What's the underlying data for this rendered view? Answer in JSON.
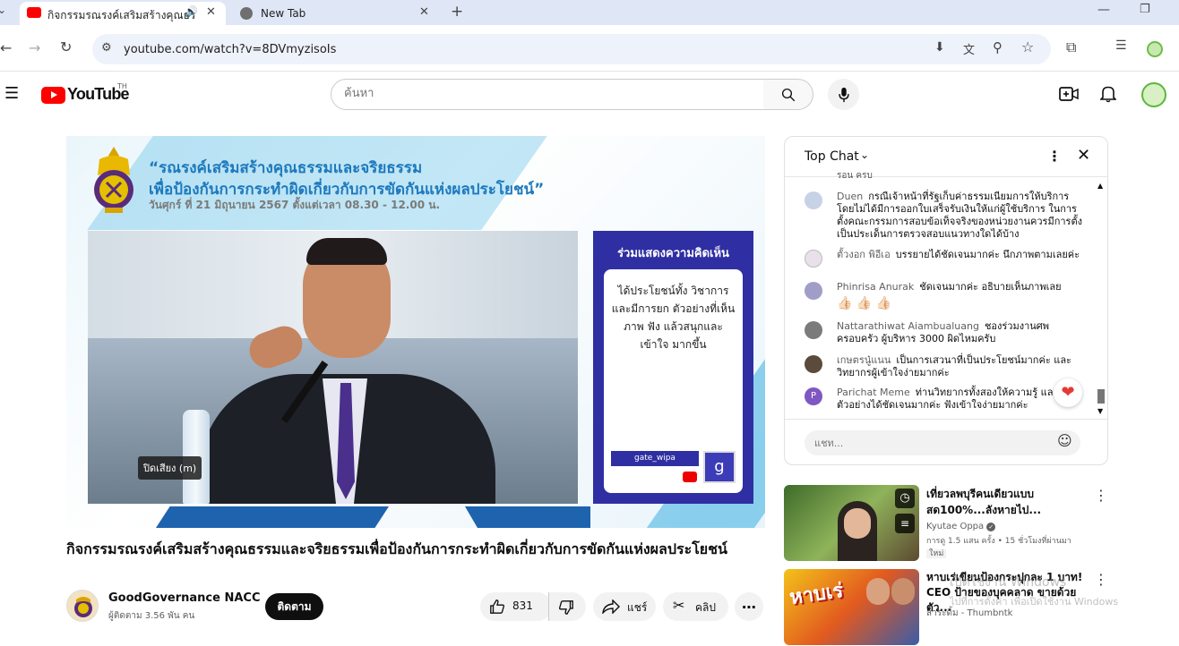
{
  "browser": {
    "tabs": [
      {
        "title": "กิจกรรมรณรงค์เสริมสร้างคุณธรร",
        "active": true
      },
      {
        "title": "New Tab",
        "active": false
      }
    ],
    "url": "youtube.com/watch?v=8DVmyzisoIs"
  },
  "youtube": {
    "logo_text": "YouTube",
    "country_code": "TH",
    "search_placeholder": "ค้นหา"
  },
  "video": {
    "banner_line1": "“รณรงค์เสริมสร้างคุณธรรมและจริยธรรม",
    "banner_line2": "เพื่อป้องกันการกระทำผิดเกี่ยวกับการขัดกันแห่งผลประโยชน์”",
    "banner_date": "วันศุกร์ ที่ 21 มิถุนายน 2567 ตั้งแต่เวลา 08.30 - 12.00 น.",
    "comment_panel_title": "ร่วมแสดงความคิดเห็น",
    "comment_panel_text": "ได้ประโยชน์ทั้ง วิชาการ และมีการยก ตัวอย่างที่เห็นภาพ ฟัง แล้วสนุกและเข้าใจ มากขึ้น",
    "comment_user": "gate_wipa",
    "comment_avatar_letter": "g",
    "mute_tooltip": "ปิดเสียง (m)",
    "title": "กิจกรรมรณรงค์เสริมสร้างคุณธรรมและจริยธรรมเพื่อป้องกันการกระทำผิดเกี่ยวกับการขัดกันแห่งผลประโยชน์",
    "channel_name": "GoodGovernance NACC",
    "subscribers": "ผู้ติดตาม 3.56 พัน คน",
    "subscribe_label": "ติดตาม",
    "like_count": "831",
    "share_label": "แชร์",
    "clip_label": "คลิป"
  },
  "chat": {
    "title": "Top Chat",
    "partial_top": "ร้อน ครับ",
    "messages": [
      {
        "author": "Duen",
        "text": "กรณีเจ้าหน้าที่รัฐเก็บค่าธรรมเนียมการให้บริการโดยไม่ได้มีการออกใบเสร็จรับเงินให้แก่ผู้ใช้บริการ ในการตั้งคณะกรรมการสอบข้อเท็จจริงของหน่วยงานควรมีการตั้งเป็นประเด็นการตรวจสอบแนวทางใดได้บ้าง"
      },
      {
        "author": "ตั้วงอก พิอีเอ",
        "text": "บรรยายได้ชัดเจนมากค่ะ นึกภาพตามเลยค่ะ"
      },
      {
        "author": "Phinrisa Anurak",
        "text": "ชัดเจนมากค่ะ อธิบายเห็นภาพเลย",
        "emoji": "👍🏻 👍🏻 👍🏻"
      },
      {
        "author": "Nattarathiwat Aiambualuang",
        "text": "ชองร่วมงานศพครอบครัว ผู้บริหาร 3000 ผิดไหมครับ"
      },
      {
        "author": "เกษตรนู๋แนน",
        "text": "เป็นการเสวนาที่เป็นประโยชน์มากค่ะ และวิทยากรผู้เข้าใจง่ายมากค่ะ"
      },
      {
        "author": "Parichat Meme",
        "text": "ท่านวิทยากรทั้งสองให้ความรู้ และยกตัวอย่างได้ชัดเจนมากค่ะ ฟังเข้าใจง่ายมากค่ะ",
        "avatar_letter": "P"
      }
    ],
    "input_placeholder": "แชท..."
  },
  "recommendations": [
    {
      "title": "เที่ยวลพบุรีคนเดียวแบบสด100%...ลังหายไป...",
      "channel": "Kyutae Oppa",
      "meta": "การดู 1.5 แสน ครั้ง • 15 ชั่วโมงที่ผ่านมา",
      "badge": "ใหม่",
      "thumb_text": ""
    },
    {
      "title": "หาบเร่เขียนป้องกระปุกละ 1 บาท! CEO ป้ายของบุคคลาด ขายด้วยตัว...",
      "channel": "สาระดิ้ม - Thumbntk",
      "meta": "",
      "badge": "",
      "thumb_text": "หาบเร่"
    }
  ],
  "os": {
    "watermark_line1": "เปิดใช้งาน Windows",
    "watermark_line2": "ไปที่การตั้งค่า เพื่อเปิดใช้งาน Windows"
  },
  "colors": {
    "yt_red": "#ff0000",
    "banner_blue": "#1d79bd",
    "panel_indigo": "#2f2fa3",
    "heart_red": "#e53935"
  }
}
